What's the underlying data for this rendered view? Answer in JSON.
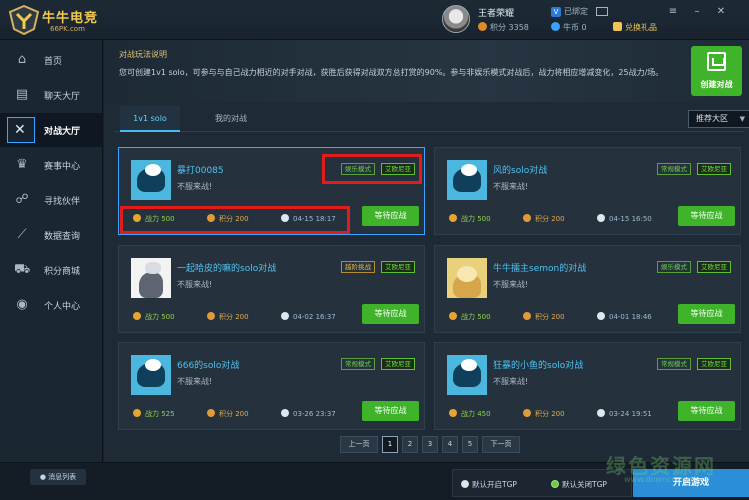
{
  "app": {
    "logo_name": "牛牛电竞",
    "logo_sub": "66PK.com"
  },
  "user": {
    "name": "王者荣耀",
    "bound_label": "已绑定",
    "score": "积分 3358",
    "coins": "牛币 0",
    "gift": "兑换礼品"
  },
  "sidebar": {
    "items": [
      {
        "label": "首页",
        "icon": "home-icon"
      },
      {
        "label": "聊天大厅",
        "icon": "chat-icon"
      },
      {
        "label": "对战大厅",
        "icon": "swords-icon"
      },
      {
        "label": "赛事中心",
        "icon": "trophy-icon"
      },
      {
        "label": "寻找伙伴",
        "icon": "handshake-icon"
      },
      {
        "label": "数据查询",
        "icon": "chart-icon"
      },
      {
        "label": "积分商城",
        "icon": "cart-icon"
      },
      {
        "label": "个人中心",
        "icon": "user-icon"
      }
    ]
  },
  "header": {
    "rules_title": "对战玩法说明",
    "rules_text": "您可创建1v1 solo，可参与与自己战力相近的对手对战，获胜后获得对战双方总打赏的90%。参与非娱乐模式对战后，战力将相应增减变化，25战力/场。",
    "create_label": "创建对战"
  },
  "tabs": {
    "solo": "1v1 solo",
    "mine": "我的对战",
    "region": "推荐大区"
  },
  "cards": [
    {
      "title": "暴打00085",
      "desc": "不服来战!",
      "mode": "娱乐模式",
      "game": "艾欧尼亚",
      "power": "战力 500",
      "score": "积分 200",
      "time": "04-15 18:17",
      "btn": "等待应战"
    },
    {
      "title": "风的solo对战",
      "desc": "不服来战!",
      "mode": "常规模式",
      "game": "艾欧尼亚",
      "power": "战力 500",
      "score": "积分 200",
      "time": "04-15 16:50",
      "btn": "等待应战"
    },
    {
      "title": "一起哈皮的嘛的solo对战",
      "desc": "不服来战!",
      "mode": "越阶挑战",
      "game": "艾欧尼亚",
      "power": "战力 500",
      "score": "积分 200",
      "time": "04-02 16:37",
      "btn": "等待应战"
    },
    {
      "title": "牛牛擂主semon的对战",
      "desc": "不服来战!",
      "mode": "娱乐模式",
      "game": "艾欧尼亚",
      "power": "战力 500",
      "score": "积分 200",
      "time": "04-01 18:46",
      "btn": "等待应战"
    },
    {
      "title": "666的solo对战",
      "desc": "不服来战!",
      "mode": "常规模式",
      "game": "艾欧尼亚",
      "power": "战力 525",
      "score": "积分 200",
      "time": "03-26 23:37",
      "btn": "等待应战"
    },
    {
      "title": "狂暴的小鱼的solo对战",
      "desc": "不服来战!",
      "mode": "常规模式",
      "game": "艾欧尼亚",
      "power": "战力 450",
      "score": "积分 200",
      "time": "03-24 19:51",
      "btn": "等待应战"
    }
  ],
  "pager": {
    "prev": "上一页",
    "pages": [
      "1",
      "2",
      "3",
      "4",
      "5"
    ],
    "next": "下一页"
  },
  "footer": {
    "msg": "消息列表",
    "tgp_on": "默认开启TGP",
    "tgp_off": "默认关闭TGP",
    "start": "开启游戏"
  },
  "watermark": {
    "text": "绿色资源网",
    "url": "www.downcc.com"
  },
  "colors": {
    "accent_green": "#3fb42a",
    "accent_blue": "#2b8fd8",
    "title_cyan": "#4fc1f0",
    "highlight_red": "#e21b1b"
  }
}
